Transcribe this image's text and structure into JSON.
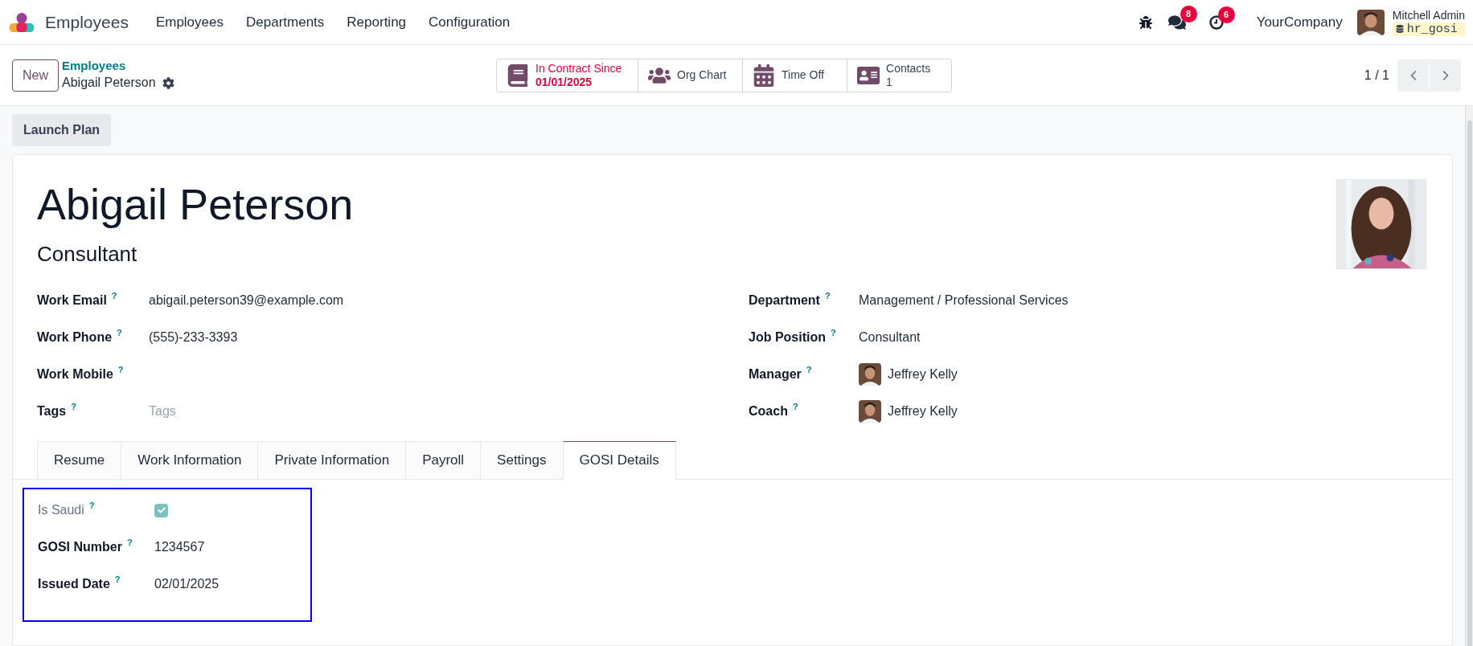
{
  "app": {
    "name": "Employees"
  },
  "menu": [
    "Employees",
    "Departments",
    "Reporting",
    "Configuration"
  ],
  "systray": {
    "messages_count": "8",
    "activities_count": "6",
    "company": "YourCompany",
    "user": "Mitchell Admin",
    "database": "hr_gosi"
  },
  "control_panel": {
    "new_button": "New",
    "breadcrumb": "Employees",
    "record": "Abigail Peterson",
    "pager": "1 / 1",
    "smart_buttons": [
      {
        "kind": "contract",
        "label": "In Contract Since",
        "value": "01/01/2025"
      },
      {
        "kind": "org",
        "label": "Org Chart"
      },
      {
        "kind": "timeoff",
        "label": "Time Off"
      },
      {
        "kind": "contacts",
        "label": "Contacts",
        "value": "1"
      }
    ]
  },
  "action_buttons": [
    "Launch Plan"
  ],
  "employee": {
    "name": "Abigail Peterson",
    "job_title": "Consultant"
  },
  "fields_left": [
    {
      "kind": "text",
      "label": "Work Email",
      "help": "?",
      "value": "abigail.peterson39@example.com"
    },
    {
      "kind": "text",
      "label": "Work Phone",
      "help": "?",
      "value": "(555)-233-3393"
    },
    {
      "kind": "text",
      "label": "Work Mobile",
      "help": "?"
    },
    {
      "kind": "tags",
      "label": "Tags",
      "help": "?",
      "placeholder": "Tags"
    }
  ],
  "fields_right": [
    {
      "kind": "text",
      "label": "Department",
      "help": "?",
      "value": "Management / Professional Services"
    },
    {
      "kind": "text",
      "label": "Job Position",
      "help": "?",
      "value": "Consultant"
    },
    {
      "kind": "person",
      "label": "Manager",
      "help": "?",
      "value": "Jeffrey Kelly"
    },
    {
      "kind": "person",
      "label": "Coach",
      "help": "?",
      "value": "Jeffrey Kelly"
    }
  ],
  "tabs": [
    {
      "label": "Resume",
      "selected": false
    },
    {
      "label": "Work Information",
      "selected": false
    },
    {
      "label": "Private Information",
      "selected": false
    },
    {
      "label": "Payroll",
      "selected": false
    },
    {
      "label": "Settings",
      "selected": false
    },
    {
      "label": "GOSI Details",
      "selected": true
    }
  ],
  "gosi_fields": [
    {
      "kind": "checkbox",
      "label": "Is Saudi",
      "help": "?",
      "checked": true,
      "readonly": true
    },
    {
      "kind": "text",
      "label": "GOSI Number",
      "help": "?",
      "value": "1234567"
    },
    {
      "kind": "text",
      "label": "Issued Date",
      "help": "?",
      "value": "02/01/2025"
    }
  ]
}
